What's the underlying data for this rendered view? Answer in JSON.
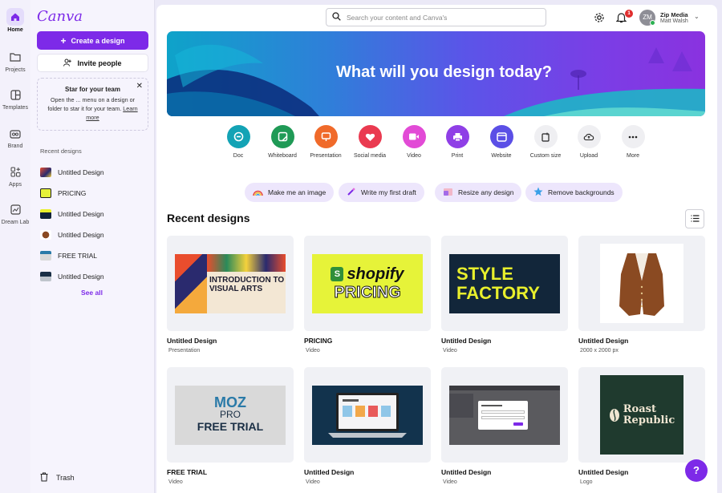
{
  "app": {
    "logo": "Canva"
  },
  "rail": {
    "home": "Home",
    "projects": "Projects",
    "templates": "Templates",
    "brand": "Brand",
    "apps": "Apps",
    "dream_lab": "Dream Lab"
  },
  "sidebar": {
    "create_label": "Create a design",
    "invite_label": "Invite people",
    "star_title": "Star for your team",
    "star_body": "Open the ... menu on a design or folder to star it for your team.",
    "star_link": "Learn more",
    "recent_header": "Recent designs",
    "recent_items": [
      {
        "label": "Untitled Design"
      },
      {
        "label": "PRICING"
      },
      {
        "label": "Untitled Design"
      },
      {
        "label": "Untitled Design"
      },
      {
        "label": "FREE TRIAL"
      },
      {
        "label": "Untitled Design"
      }
    ],
    "see_all": "See all",
    "trash": "Trash"
  },
  "header": {
    "search_placeholder": "Search your content and Canva's",
    "notification_count": "1",
    "account_initials": "ZM",
    "account_team": "Zip Media",
    "account_user": "Matt Walsh"
  },
  "hero": {
    "title": "What will you design today?"
  },
  "tools": [
    {
      "label": "Doc",
      "color": "#13a3b5"
    },
    {
      "label": "Whiteboard",
      "color": "#1f9a56"
    },
    {
      "label": "Presentation",
      "color": "#f06a2a"
    },
    {
      "label": "Social media",
      "color": "#ea3a50"
    },
    {
      "label": "Video",
      "color": "#e24bd6"
    },
    {
      "label": "Print",
      "color": "#8f3fe6"
    },
    {
      "label": "Website",
      "color": "#5b4fe6"
    },
    {
      "label": "Custom size",
      "color": "#efeff2"
    },
    {
      "label": "Upload",
      "color": "#efeff2"
    },
    {
      "label": "More",
      "color": "#efeff2"
    }
  ],
  "ai_pills": [
    {
      "label": "Make me an image"
    },
    {
      "label": "Write my first draft"
    },
    {
      "label": "Resize any design"
    },
    {
      "label": "Remove backgrounds"
    }
  ],
  "recent": {
    "title": "Recent designs",
    "cards": [
      {
        "title": "Untitled Design",
        "subtitle": "Presentation",
        "thumb_text": "INTRODUCTION TO VISUAL ARTS"
      },
      {
        "title": "PRICING",
        "subtitle": "Video",
        "thumb_text": "shopify",
        "thumb_text2": "PRICING"
      },
      {
        "title": "Untitled Design",
        "subtitle": "Video",
        "thumb_text": "STYLE",
        "thumb_text2": "FACTORY"
      },
      {
        "title": "Untitled Design",
        "subtitle": "2000 x 2000 px",
        "thumb_text": ""
      },
      {
        "title": "FREE TRIAL",
        "subtitle": "Video",
        "thumb_text": "MOZ",
        "thumb_text2": "PRO",
        "thumb_text3": "FREE TRIAL"
      },
      {
        "title": "Untitled Design",
        "subtitle": "Video",
        "thumb_text": ""
      },
      {
        "title": "Untitled Design",
        "subtitle": "Video",
        "thumb_text": ""
      },
      {
        "title": "Untitled Design",
        "subtitle": "Logo",
        "thumb_text": "Roast",
        "thumb_text2": "Republic"
      }
    ]
  },
  "help": {
    "label": "?"
  },
  "colors": {
    "accent": "#7d2ae8",
    "badge": "#e02d2d",
    "online": "#2db152"
  }
}
